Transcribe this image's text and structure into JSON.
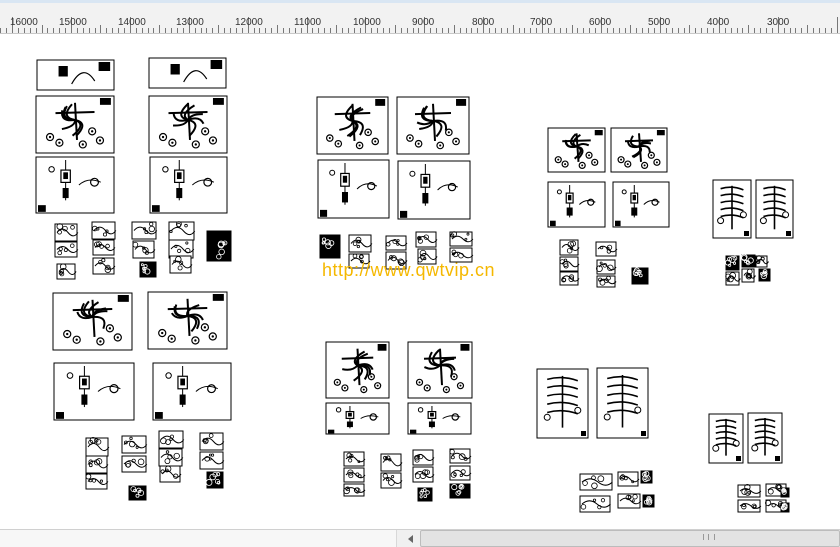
{
  "ruler": {
    "labels": [
      "16000",
      "15000",
      "14000",
      "13000",
      "12000",
      "11000",
      "10000",
      "9000",
      "8000",
      "7000",
      "6000",
      "5000",
      "4000",
      "3000"
    ]
  },
  "watermark": {
    "text": "http://www.qwtvip.cn"
  },
  "colors": {
    "ruler_bg": "#f2f2f2",
    "canvas_bg": "#ffffff",
    "watermark": "#f5b800",
    "line": "#000000"
  },
  "icons": {
    "scroll_left": "triangle-left-icon",
    "scroll_grip": "grip-icon"
  }
}
